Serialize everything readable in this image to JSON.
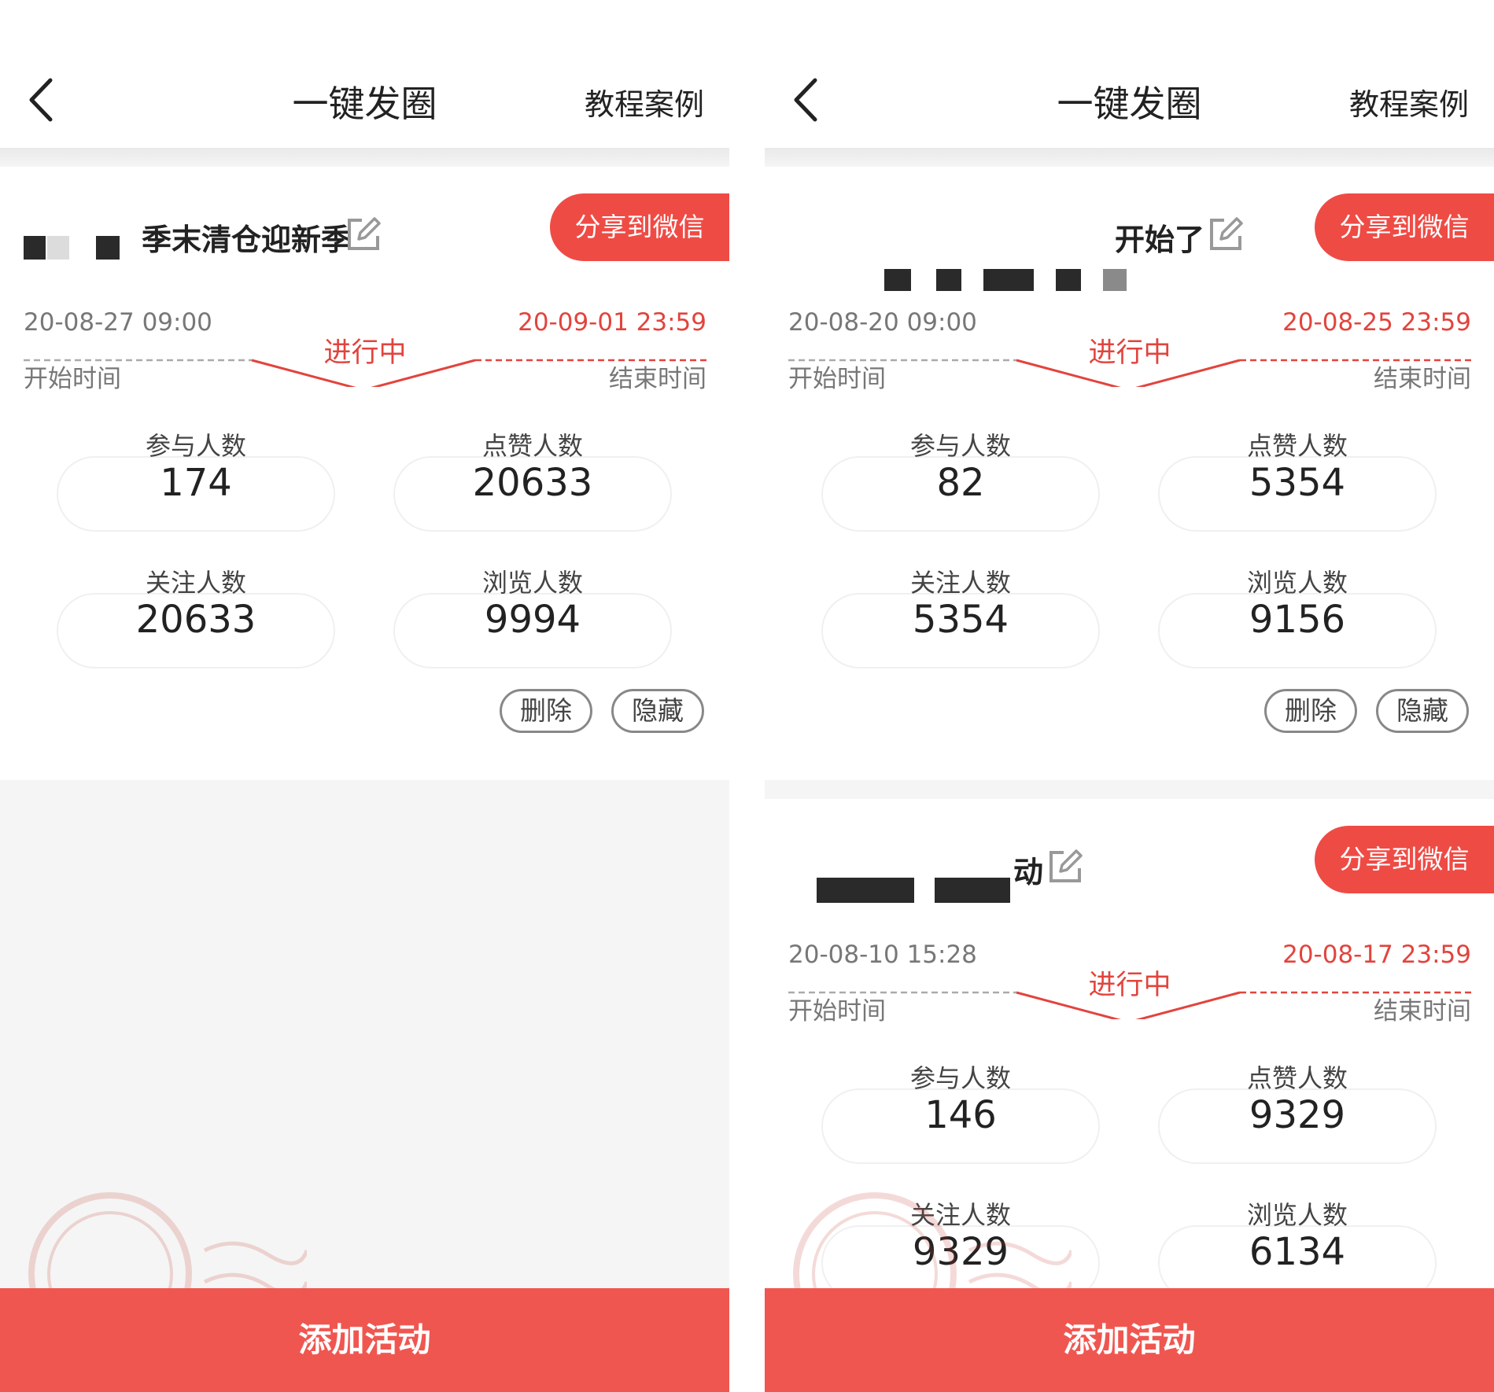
{
  "header": {
    "title": "一键发圈",
    "link": "教程案例"
  },
  "share_label": "分享到微信",
  "status_label": "进行中",
  "start_label": "开始时间",
  "end_label": "结束时间",
  "stat_labels": {
    "participants": "参与人数",
    "likes": "点赞人数",
    "follows": "关注人数",
    "views": "浏览人数"
  },
  "actions": {
    "delete": "删除",
    "hide": "隐藏"
  },
  "add_activity_label": "添加活动",
  "colors": {
    "accent": "#ef4b45",
    "status_red": "#e2443d",
    "bottom_bar": "#f05650"
  },
  "left_screen": {
    "cards": [
      {
        "title_visible": "季末清仓迎新季",
        "start_time": "20-08-27 09:00",
        "end_time": "20-09-01 23:59",
        "participants": "174",
        "likes": "20633",
        "follows": "20633",
        "views": "9994"
      }
    ]
  },
  "right_screen": {
    "cards": [
      {
        "title_visible": "开始了",
        "start_time": "20-08-20 09:00",
        "end_time": "20-08-25 23:59",
        "participants": "82",
        "likes": "5354",
        "follows": "5354",
        "views": "9156"
      },
      {
        "title_visible": "动",
        "start_time": "20-08-10 15:28",
        "end_time": "20-08-17 23:59",
        "participants": "146",
        "likes": "9329",
        "follows": "9329",
        "views": "6134"
      }
    ]
  }
}
